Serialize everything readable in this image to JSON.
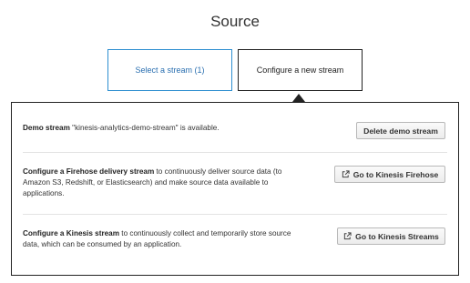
{
  "page": {
    "title": "Source"
  },
  "choices": {
    "select_stream": "Select a stream (1)",
    "configure_new": "Configure a new stream"
  },
  "rows": {
    "demo": {
      "bold": "Demo stream",
      "text": " \"kinesis-analytics-demo-stream\" is available.",
      "button": "Delete demo stream"
    },
    "firehose": {
      "bold": "Configure a Firehose delivery stream",
      "text": " to continuously deliver source data (to Amazon S3, Redshift, or Elasticsearch) and make source data available to applications.",
      "button": "Go to Kinesis Firehose",
      "button_icon": "external-link-icon"
    },
    "kinesis": {
      "bold": "Configure a Kinesis stream",
      "text": " to continuously collect and temporarily store source data, which can be consumed by an application.",
      "button": "Go to Kinesis Streams",
      "button_icon": "external-link-icon"
    }
  },
  "colors": {
    "selected_border": "#2e8fd0",
    "selected_text": "#2a6fb0",
    "active_border": "#222222"
  }
}
